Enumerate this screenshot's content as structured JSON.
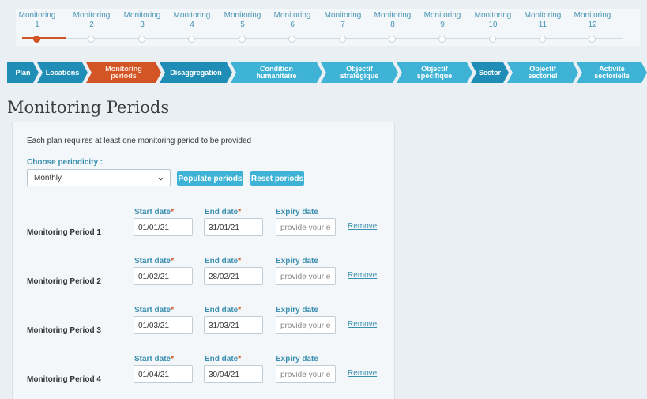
{
  "stepper": {
    "steps": [
      {
        "label": "Monitoring",
        "num": "1"
      },
      {
        "label": "Monitoring",
        "num": "2"
      },
      {
        "label": "Monitoring",
        "num": "3"
      },
      {
        "label": "Monitoring",
        "num": "4"
      },
      {
        "label": "Monitoring",
        "num": "5"
      },
      {
        "label": "Monitoring",
        "num": "6"
      },
      {
        "label": "Monitoring",
        "num": "7"
      },
      {
        "label": "Monitoring",
        "num": "8"
      },
      {
        "label": "Monitoring",
        "num": "9"
      },
      {
        "label": "Monitoring",
        "num": "10"
      },
      {
        "label": "Monitoring",
        "num": "11"
      },
      {
        "label": "Monitoring",
        "num": "12"
      }
    ],
    "active_index": 0
  },
  "crumbs": [
    {
      "line1": "Plan",
      "line2": ""
    },
    {
      "line1": "Locations",
      "line2": ""
    },
    {
      "line1": "Monitoring",
      "line2": "periods"
    },
    {
      "line1": "Disaggregation",
      "line2": ""
    },
    {
      "line1": "Condition",
      "line2": "humanitaire"
    },
    {
      "line1": "Objectif",
      "line2": "stratégique"
    },
    {
      "line1": "Objectif",
      "line2": "spécifique"
    },
    {
      "line1": "Sector",
      "line2": ""
    },
    {
      "line1": "Objectif",
      "line2": "sectoriel"
    },
    {
      "line1": "Activité",
      "line2": "sectorielle"
    }
  ],
  "page_title": "Monitoring Periods",
  "intro": "Each plan requires at least one monitoring period to be provided",
  "periodicity": {
    "label": "Choose periodicity :",
    "value": "Monthly"
  },
  "buttons": {
    "populate": "Populate periods",
    "reset": "Reset periods"
  },
  "field_labels": {
    "start": "Start date",
    "end": "End date",
    "expiry": "Expiry date",
    "required_mark": "*",
    "expiry_placeholder": "provide your e",
    "remove": "Remove"
  },
  "periods": [
    {
      "name": "Monitoring Period 1",
      "start": "01/01/21",
      "end": "31/01/21"
    },
    {
      "name": "Monitoring Period 2",
      "start": "01/02/21",
      "end": "28/02/21"
    },
    {
      "name": "Monitoring Period 3",
      "start": "01/03/21",
      "end": "31/03/21"
    },
    {
      "name": "Monitoring Period 4",
      "start": "01/04/21",
      "end": "30/04/21"
    }
  ],
  "colors": {
    "accent": "#3fb3d6",
    "accent_dark": "#1f8db5",
    "active": "#d35424",
    "label_blue": "#3a8fb0",
    "background": "#e9eff3"
  }
}
